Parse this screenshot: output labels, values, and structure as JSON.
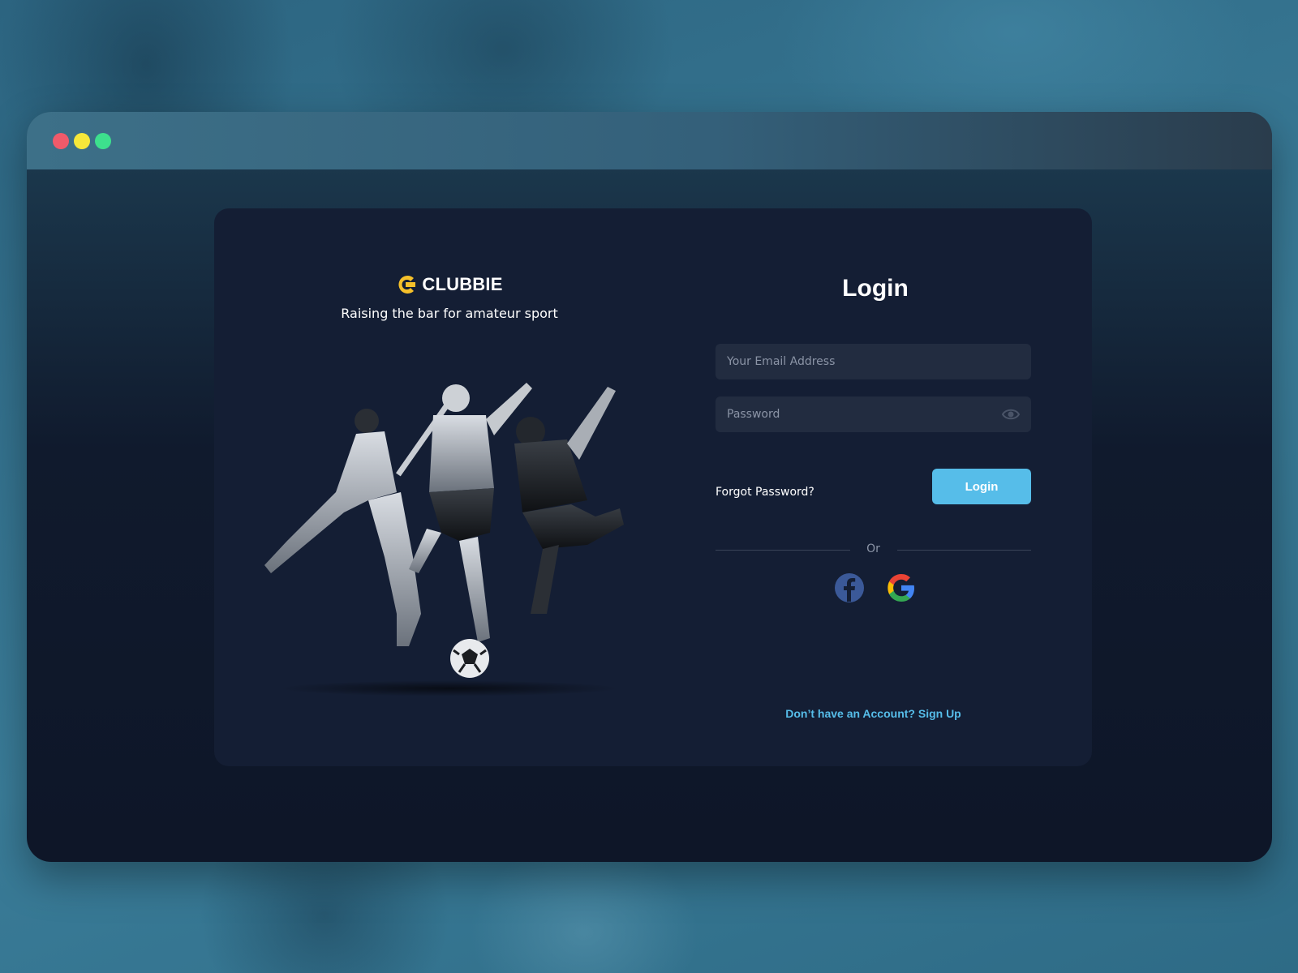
{
  "window": {
    "controls": [
      "close",
      "minimize",
      "maximize"
    ]
  },
  "brand": {
    "name": "CLUBBIE",
    "tagline": "Raising the bar for amateur sport",
    "logo_icon": "clubbie-c-logo-icon",
    "accent": "#f5c02a"
  },
  "hero": {
    "image": "athletes-collage-image"
  },
  "login": {
    "title": "Login",
    "email_placeholder": "Your Email Address",
    "email_value": "",
    "password_placeholder": "Password",
    "password_value": "",
    "show_password_icon": "eye-icon",
    "forgot_label": "Forgot Password?",
    "submit_label": "Login",
    "divider_label": "Or",
    "social": [
      {
        "name": "facebook-icon"
      },
      {
        "name": "google-icon"
      }
    ],
    "signup_label": "Don’t have an Account? Sign Up"
  },
  "colors": {
    "primary": "#56bde9",
    "card": "#141e34",
    "field": "#222c40"
  }
}
